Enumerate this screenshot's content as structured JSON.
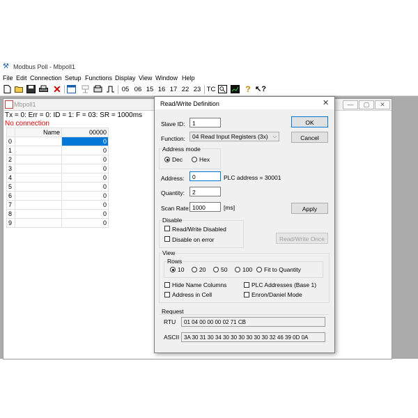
{
  "app": {
    "title": "Modbus Poll - Mbpoll1"
  },
  "menu": [
    "File",
    "Edit",
    "Connection",
    "Setup",
    "Functions",
    "Display",
    "View",
    "Window",
    "Help"
  ],
  "toolbar": {
    "function_codes": [
      "05",
      "06",
      "15",
      "16",
      "17",
      "22",
      "23"
    ],
    "tc_label": "TC"
  },
  "child": {
    "title": "Mbpoll1",
    "status_line": "Tx = 0: Err = 0: ID = 1: F = 03: SR = 1000ms",
    "connection_status": "No connection",
    "grid": {
      "header_name": "Name",
      "header_value": "00000",
      "rows": [
        {
          "idx": "0",
          "name": "",
          "value": "0"
        },
        {
          "idx": "1",
          "name": "",
          "value": "0"
        },
        {
          "idx": "2",
          "name": "",
          "value": "0"
        },
        {
          "idx": "3",
          "name": "",
          "value": "0"
        },
        {
          "idx": "4",
          "name": "",
          "value": "0"
        },
        {
          "idx": "5",
          "name": "",
          "value": "0"
        },
        {
          "idx": "6",
          "name": "",
          "value": "0"
        },
        {
          "idx": "7",
          "name": "",
          "value": "0"
        },
        {
          "idx": "8",
          "name": "",
          "value": "0"
        },
        {
          "idx": "9",
          "name": "",
          "value": "0"
        }
      ]
    }
  },
  "dialog": {
    "title": "Read/Write Definition",
    "close": "✕",
    "slave_id_label": "Slave ID:",
    "slave_id_value": "1",
    "function_label": "Function:",
    "function_value": "04 Read Input Registers (3x)",
    "address_mode_title": "Address mode",
    "dec_label": "Dec",
    "hex_label": "Hex",
    "address_label": "Address:",
    "address_value": "0",
    "plc_address": "PLC address = 30001",
    "quantity_label": "Quantity:",
    "quantity_value": "2",
    "scan_rate_label": "Scan Rate:",
    "scan_rate_value": "1000",
    "scan_rate_unit": "[ms]",
    "ok": "OK",
    "cancel": "Cancel",
    "apply": "Apply",
    "disable_title": "Disable",
    "rw_disabled": "Read/Write Disabled",
    "disable_on_error": "Disable on error",
    "rw_once": "Read/Write Once",
    "view_title": "View",
    "rows_title": "Rows",
    "rows_options": [
      "10",
      "20",
      "50",
      "100",
      "Fit to Quantity"
    ],
    "hide_name_columns": "Hide Name Columns",
    "address_in_cell": "Address in Cell",
    "plc_addresses": "PLC Addresses (Base 1)",
    "enron_mode": "Enron/Daniel Mode",
    "request_title": "Request",
    "rtu_label": "RTU",
    "rtu_value": "01 04 00 00 00 02 71 CB",
    "ascii_label": "ASCII",
    "ascii_value": "3A 30 31 30 34 30 30 30 30 30 30 32 46 39 0D 0A"
  }
}
